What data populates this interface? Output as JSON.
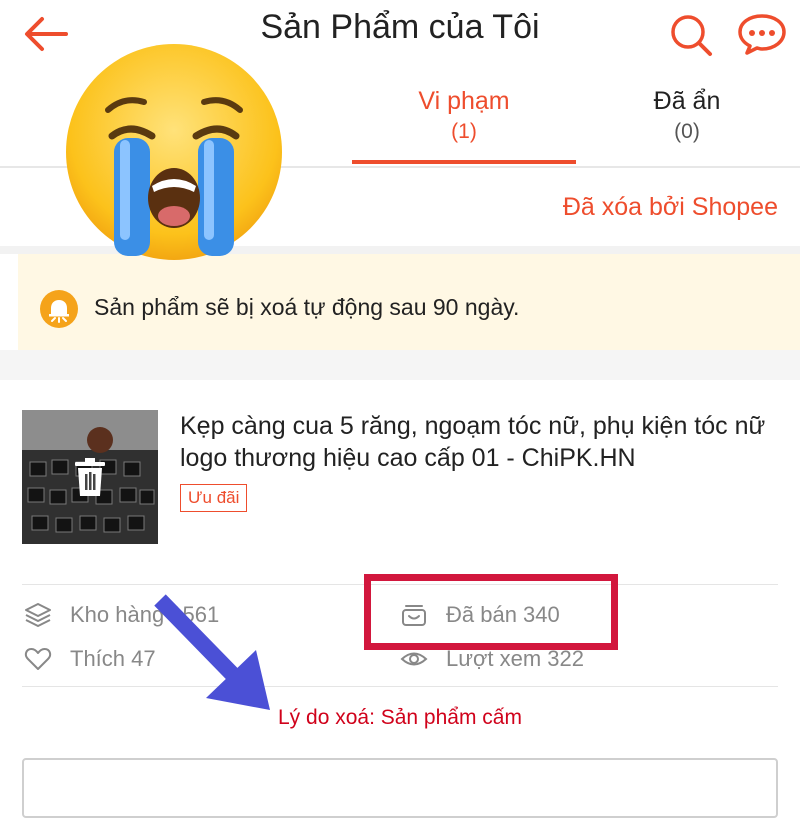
{
  "header": {
    "title": "Sản Phẩm của Tôi"
  },
  "tabs": [
    {
      "label": "Vi phạm",
      "count": "(1)"
    },
    {
      "label": "Đã ẩn",
      "count": "(0)"
    }
  ],
  "filter": {
    "label": "Đã xóa bởi Shopee"
  },
  "notice": {
    "text": "Sản phẩm sẽ bị xoá tự động sau 90 ngày."
  },
  "product": {
    "name": "Kẹp càng cua 5 răng, ngoạm tóc nữ, phụ kiện tóc nữ logo thương hiệu cao cấp 01 - ChiPK.HN",
    "promo": "Ưu đãi",
    "stock": "Kho hàng 1561",
    "sold": "Đã bán 340",
    "likes": "Thích 47",
    "views": "Lượt xem 322",
    "reason": "Lý do xoá: Sản phẩm cấm"
  },
  "colors": {
    "accent": "#ee4d2d",
    "notice_bg": "#fff8e4",
    "highlight": "#d2173d",
    "arrow": "#4b50d6",
    "reason": "#d0021b"
  },
  "icons": [
    "back-arrow-icon",
    "search-icon",
    "chat-icon",
    "bell-icon",
    "trash-icon",
    "stack-icon",
    "basket-icon",
    "heart-icon",
    "eye-icon",
    "crying-face-emoji"
  ]
}
